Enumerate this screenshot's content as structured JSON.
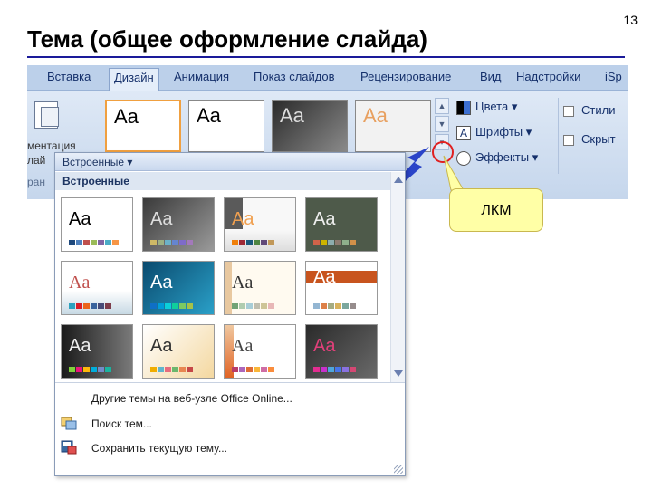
{
  "slide": {
    "title": "Тема (общее оформление слайда)",
    "number": "13",
    "callout": "ЛКМ"
  },
  "ribbon": {
    "tabs": [
      "Вставка",
      "Дизайн",
      "Анимация",
      "Показ слайдов",
      "Рецензирование",
      "Вид",
      "Надстройки",
      "iSp"
    ],
    "active_tab": "Дизайн",
    "left_group": {
      "line1": "ментация",
      "line2": "лай",
      "line3": "ран"
    },
    "strip_aa": "Aa",
    "theme_options": {
      "colors": "Цвета",
      "fonts": "Шрифты",
      "effects": "Эффекты"
    },
    "right_group": {
      "styles": "Стили",
      "hide": "Скрыт"
    }
  },
  "dropdown": {
    "header": "Встроенные",
    "section": "Встроенные",
    "aa": "Aa",
    "items": [
      {
        "text": "Другие темы на веб-узле Office Online..."
      },
      {
        "text": "Поиск тем..."
      },
      {
        "text": "Сохранить текущую тему..."
      }
    ]
  },
  "colors": {
    "title_rule": "#1a1a99",
    "callout_bg": "#ffffa6",
    "circle": "#e02020",
    "arrow": "#2a44c8"
  }
}
